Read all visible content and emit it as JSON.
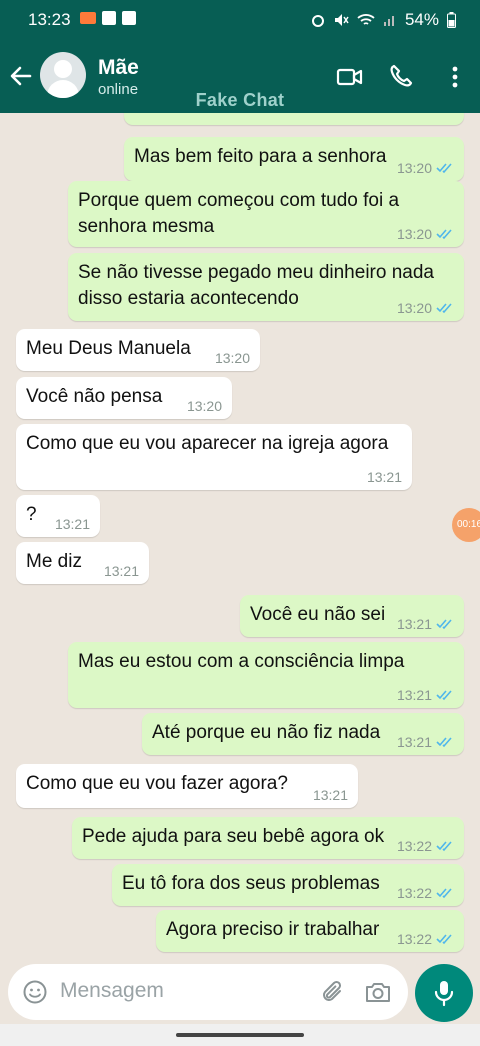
{
  "status_bar": {
    "time": "13:23",
    "battery": "54%"
  },
  "header": {
    "name": "Mãe",
    "status": "online",
    "watermark": "Fake Chat"
  },
  "messages": [
    {
      "dir": "out",
      "text": "Mas bem feito para a senhora",
      "time": "13:20"
    },
    {
      "dir": "out",
      "text": "Porque quem começou com tudo foi a senhora mesma",
      "time": "13:20"
    },
    {
      "dir": "out",
      "text": "Se não tivesse pegado meu dinheiro nada disso estaria acontecendo",
      "time": "13:20"
    },
    {
      "dir": "in",
      "text": "Meu Deus Manuela",
      "time": "13:20"
    },
    {
      "dir": "in",
      "text": "Você não pensa",
      "time": "13:20"
    },
    {
      "dir": "in",
      "text": "Como que eu vou aparecer na igreja agora",
      "time": "13:21"
    },
    {
      "dir": "in",
      "text": "?",
      "time": "13:21"
    },
    {
      "dir": "in",
      "text": "Me diz",
      "time": "13:21"
    },
    {
      "dir": "out",
      "text": "Você eu não sei",
      "time": "13:21"
    },
    {
      "dir": "out",
      "text": "Mas eu estou com a consciência limpa",
      "time": "13:21"
    },
    {
      "dir": "out",
      "text": "Até porque eu não fiz nada",
      "time": "13:21"
    },
    {
      "dir": "in",
      "text": "Como que eu vou fazer agora?",
      "time": "13:21"
    },
    {
      "dir": "out",
      "text": "Pede ajuda para seu bebê agora ok",
      "time": "13:22"
    },
    {
      "dir": "out",
      "text": "Eu tô fora dos seus problemas",
      "time": "13:22"
    },
    {
      "dir": "out",
      "text": "Agora preciso ir trabalhar",
      "time": "13:22"
    }
  ],
  "float_bubble": "00:16",
  "composer": {
    "placeholder": "Mensagem"
  },
  "colors": {
    "header": "#075e54",
    "outgoing": "#dcf8c6",
    "incoming": "#ffffff",
    "ticks": "#4fb6ec",
    "mic": "#00897b"
  }
}
